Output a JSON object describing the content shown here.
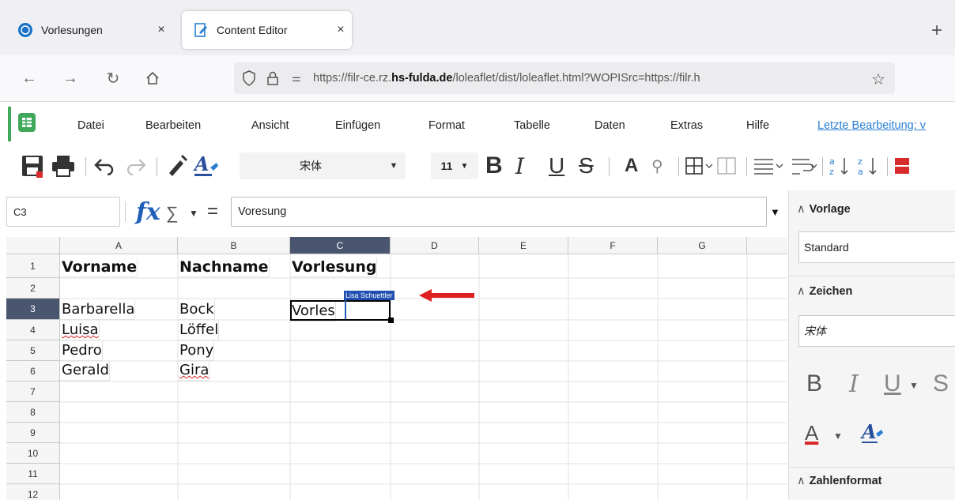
{
  "browser": {
    "tabs": [
      {
        "title": "Vorlesungen",
        "close": "×",
        "icon": "globe-icon"
      },
      {
        "title": "Content Editor",
        "close": "×",
        "icon": "edit-doc-icon"
      }
    ],
    "newtab": "+",
    "url_prefix": "https://filr-ce.rz.",
    "url_domain": "hs-fulda.de",
    "url_suffix": "/loleaflet/dist/loleaflet.html?WOPISrc=https://filr.h"
  },
  "menu": {
    "items": [
      "Datei",
      "Bearbeiten",
      "Ansicht",
      "Einfügen",
      "Format",
      "Tabelle",
      "Daten",
      "Extras",
      "Hilfe"
    ],
    "last_edit": "Letzte Bearbeitung: v"
  },
  "toolbar": {
    "font_name": "宋体",
    "font_size": "11",
    "bold": "B",
    "italic": "I",
    "underline": "U",
    "strike": "S",
    "font_color": "A"
  },
  "formula": {
    "cell_ref": "C3",
    "fx": "fx",
    "sigma": "∑",
    "equals": "=",
    "content": "Voresung"
  },
  "sheet": {
    "columns": [
      "A",
      "B",
      "C",
      "D",
      "E",
      "F",
      "G"
    ],
    "rows": [
      "1",
      "2",
      "3",
      "4",
      "5",
      "6",
      "7",
      "8",
      "9",
      "10",
      "11",
      "12"
    ],
    "selected_col": "C",
    "selected_row": "3",
    "cells": {
      "A1": "Vorname",
      "B1": "Nachname",
      "C1": "Vorlesung",
      "A3": "Barbarella",
      "B3": "Bock",
      "C3": "Vorles",
      "A4": "Luisa",
      "B4": "Löffel",
      "A5": "Pedro",
      "B5": "Pony",
      "A6": "Gerald",
      "B6": "Gira"
    },
    "collaborator": "Lisa Schuettler",
    "arrow_color": "#e02020"
  },
  "sidebar": {
    "vorlage_title": "Vorlage",
    "vorlage_value": "Standard",
    "zeichen_title": "Zeichen",
    "zeichen_font": "宋体",
    "zahlenformat_title": "Zahlenformat",
    "bold": "B",
    "italic": "I",
    "underline": "U",
    "font_color": "A"
  },
  "colors": {
    "accent": "#1f5fb8",
    "header_selected": "#4a5670",
    "calc_green": "#3fa85b",
    "link": "#2a7fd4"
  }
}
